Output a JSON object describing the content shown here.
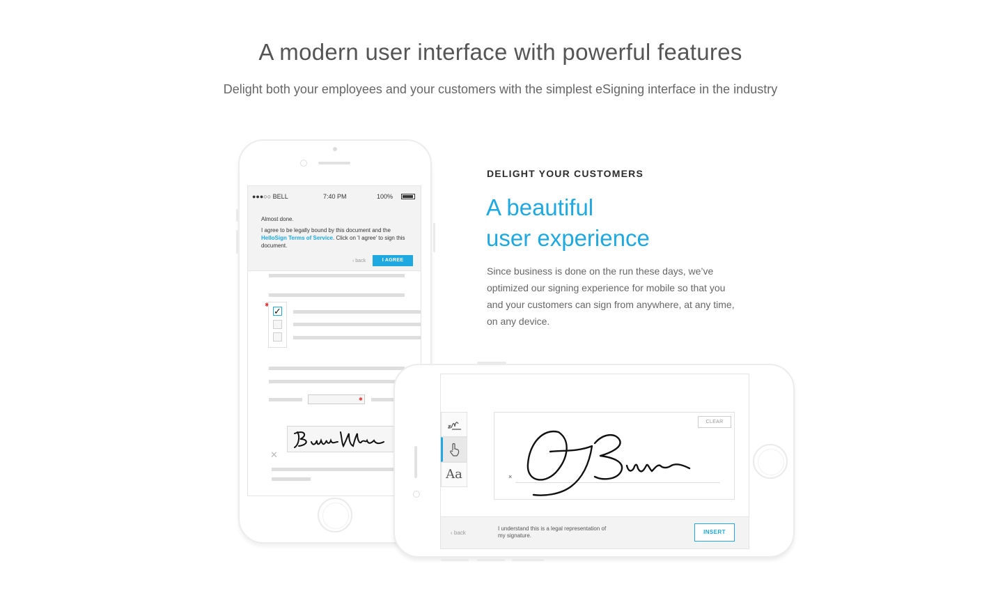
{
  "header": {
    "title": "A modern user interface with powerful features",
    "subtitle": "Delight both your employees and your customers with the simplest eSigning interface in the industry"
  },
  "feature": {
    "eyebrow": "DELIGHT YOUR CUSTOMERS",
    "title_line1": "A beautiful",
    "title_line2": "user experience",
    "body": "Since business is done on the run these days, we’ve optimized our signing experience for mobile so that you and your customers can sign from anywhere, at any time, on any device."
  },
  "portrait_phone": {
    "status": {
      "carrier": "●●●○○ BELL",
      "time": "7:40 PM",
      "battery": "100%"
    },
    "agree": {
      "title": "Almost done.",
      "text_before": "I agree to be legally bound by this document and the ",
      "link": "HelloSign Terms of Service",
      "text_after": ". Click on 'I agree' to sign this document.",
      "back": "back",
      "button": "I AGREE"
    }
  },
  "landscape_phone": {
    "tools": [
      "draw-tool",
      "touch-tool",
      "type-tool"
    ],
    "type_label": "Aa",
    "clear": "CLEAR",
    "sign_mark": "×",
    "back": "back",
    "note": "I understand this is a legal representation of my signature.",
    "insert": "INSERT"
  },
  "colors": {
    "accent": "#1fa9e0",
    "required": "#d33333"
  }
}
